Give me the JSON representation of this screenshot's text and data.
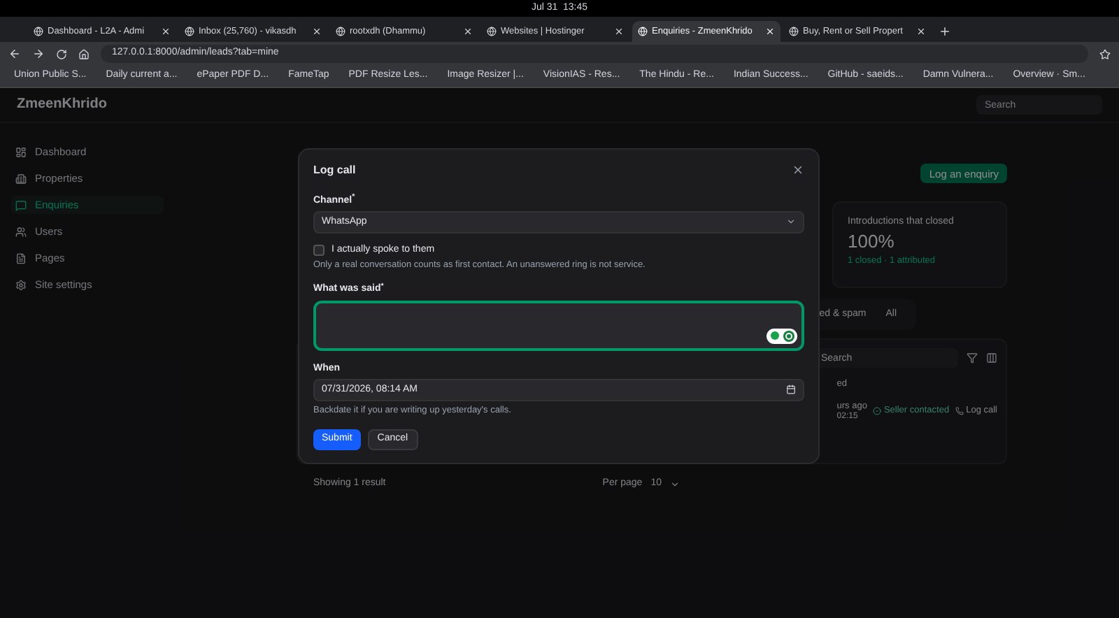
{
  "os_bar": {
    "clock": "Jul 31  13:45"
  },
  "browser": {
    "tabs": [
      {
        "title": "Dashboard - L2A - Admi",
        "selected": false
      },
      {
        "title": "Inbox (25,760) - vikasdh",
        "selected": false
      },
      {
        "title": "rootxdh (Dhammu)",
        "selected": false
      },
      {
        "title": "Websites | Hostinger",
        "selected": false
      },
      {
        "title": "Enquiries - ZmeenKhrido",
        "selected": true
      },
      {
        "title": "Buy, Rent or Sell Propert",
        "selected": false
      }
    ],
    "url": "127.0.0.1:8000/admin/leads?tab=mine",
    "bookmarks": [
      "Union Public S...",
      "Daily current a...",
      "ePaper PDF D...",
      "FameTap",
      "PDF Resize Les...",
      "Image Resizer |...",
      "VisionIAS - Res...",
      "The Hindu - Re...",
      "Indian Success...",
      "GitHub - saeids...",
      "Damn Vulnera...",
      "Overview · Sm..."
    ]
  },
  "app": {
    "brand": "ZmeenKhrido",
    "header_search": {
      "placeholder": "Search"
    },
    "sidebar": [
      {
        "label": "Dashboard",
        "selected": false
      },
      {
        "label": "Properties",
        "selected": false
      },
      {
        "label": "Enquiries",
        "selected": true
      },
      {
        "label": "Users",
        "selected": false
      },
      {
        "label": "Pages",
        "selected": false
      },
      {
        "label": "Site settings",
        "selected": false
      }
    ],
    "primary_button": "Log an enquiry",
    "stat": {
      "label": "Introductions that closed",
      "value": "100%",
      "note": "1 closed · 1 attributed"
    },
    "filter_tabs": [
      {
        "label": "ed & spam"
      },
      {
        "label": "All"
      }
    ],
    "table": {
      "search": {
        "placeholder": "Search"
      },
      "header": "ed",
      "row": {
        "time": "urs ago",
        "time_sub": "02:15",
        "status": "Seller contacted",
        "action": "Log call"
      }
    },
    "footer": {
      "summary": "Showing 1 result",
      "per_page_label": "Per page",
      "per_page_value": "10"
    }
  },
  "modal": {
    "title": "Log call",
    "channel": {
      "label": "Channel$^{*}$",
      "value": "WhatsApp"
    },
    "spoke": {
      "label": "I actually spoke to them",
      "checked": false,
      "hint": "Only a real conversation counts as first contact. An unanswered ring is not service."
    },
    "said": {
      "label": "What was said$^{*}$",
      "focused": true
    },
    "when": {
      "label": "When",
      "value": "07/31/2026, 08:14 AM",
      "hint": "Backdate it if you are writing up yesterday's calls."
    },
    "buttons": [
      {
        "label": "Submit",
        "kind": "primary"
      },
      {
        "label": "Cancel",
        "kind": "secondary"
      }
    ]
  }
}
